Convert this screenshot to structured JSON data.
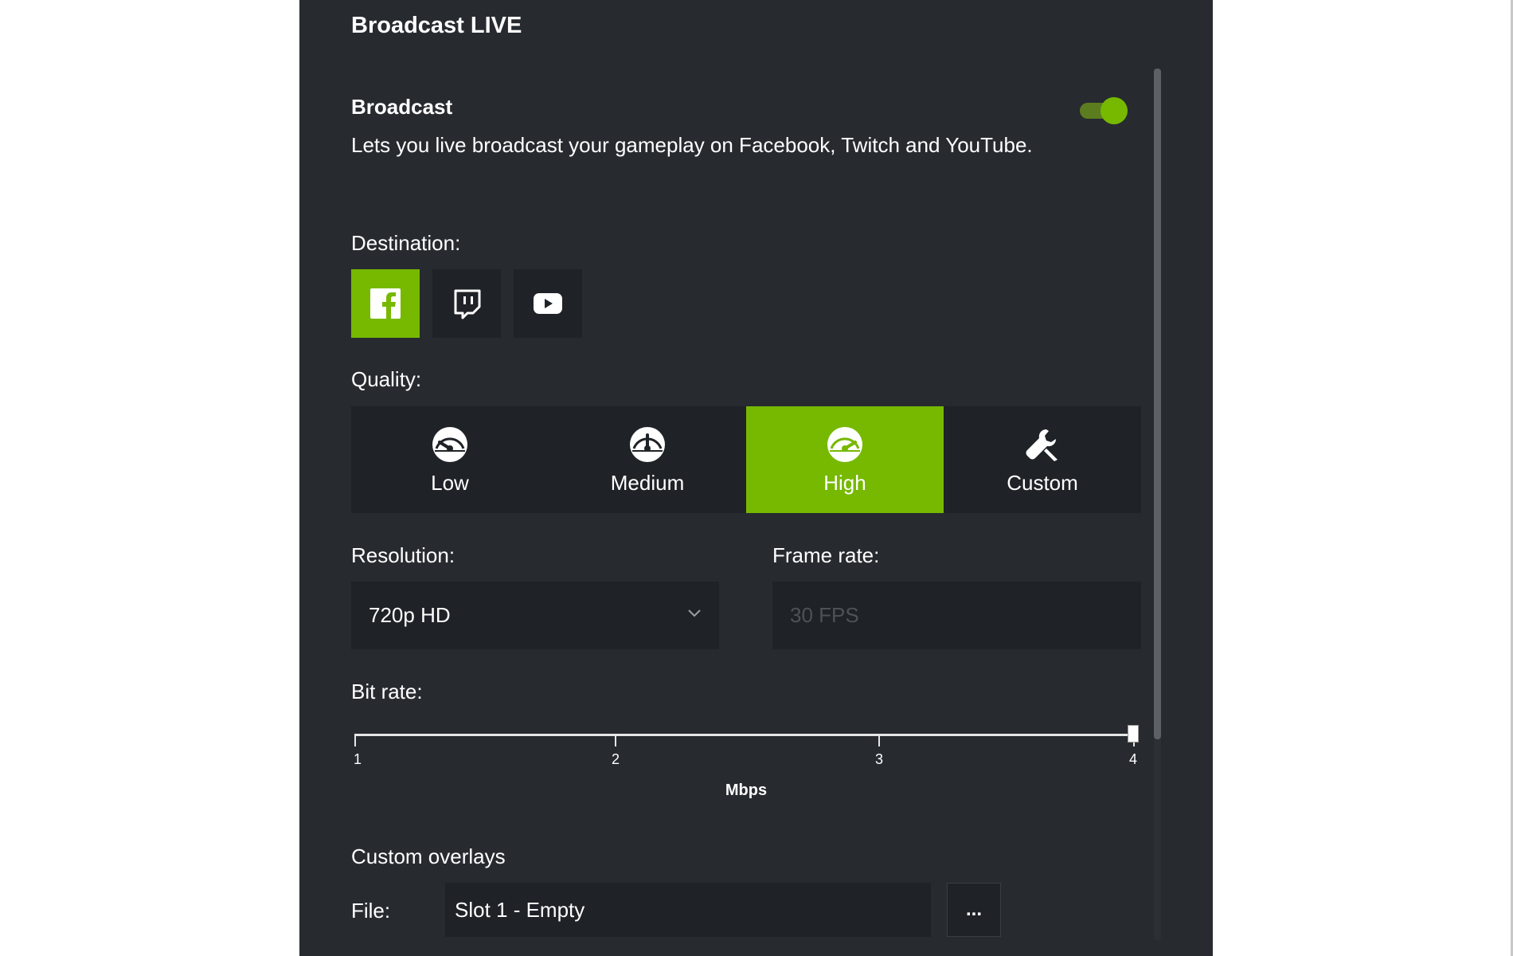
{
  "panel": {
    "title": "Broadcast LIVE"
  },
  "broadcast": {
    "title": "Broadcast",
    "description": "Lets you live broadcast your gameplay on Facebook, Twitch and YouTube.",
    "enabled": true
  },
  "destination": {
    "label": "Destination:",
    "options": [
      {
        "icon": "facebook-icon",
        "selected": true
      },
      {
        "icon": "twitch-icon",
        "selected": false
      },
      {
        "icon": "youtube-icon",
        "selected": false
      }
    ]
  },
  "quality": {
    "label": "Quality:",
    "options": [
      {
        "label": "Low",
        "icon": "gauge-low-icon"
      },
      {
        "label": "Medium",
        "icon": "gauge-medium-icon"
      },
      {
        "label": "High",
        "icon": "gauge-high-icon",
        "selected": true
      },
      {
        "label": "Custom",
        "icon": "wrench-icon"
      }
    ]
  },
  "resolution": {
    "label": "Resolution:",
    "value": "720p HD"
  },
  "frame_rate": {
    "label": "Frame rate:",
    "value": "30 FPS"
  },
  "bit_rate": {
    "label": "Bit rate:",
    "ticks": [
      "1",
      "2",
      "3",
      "4"
    ],
    "unit": "Mbps",
    "value": 4
  },
  "overlays": {
    "title": "Custom overlays",
    "file_label": "File:",
    "file_value": "Slot 1 - Empty",
    "browse_label": "..."
  },
  "colors": {
    "accent": "#76b900",
    "panel": "#272b30",
    "control": "#1f2226"
  }
}
